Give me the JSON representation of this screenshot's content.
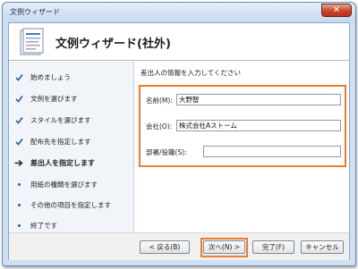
{
  "window": {
    "title": "文例ウィザード",
    "close_glyph": "✕"
  },
  "header": {
    "title": "文例ウィザード(社外)",
    "icon": "document-icon"
  },
  "nav": {
    "items": [
      {
        "label": "始めましょう",
        "state": "done"
      },
      {
        "label": "文例を選びます",
        "state": "done"
      },
      {
        "label": "スタイルを選びます",
        "state": "done"
      },
      {
        "label": "配布先を指定します",
        "state": "done"
      },
      {
        "label": "差出人を指定します",
        "state": "current"
      },
      {
        "label": "用紙の種類を選びます",
        "state": "pending"
      },
      {
        "label": "その他の項目を指定します",
        "state": "pending"
      },
      {
        "label": "終了です",
        "state": "pending"
      }
    ]
  },
  "main": {
    "instruction": "差出人の情報を入力してください",
    "fields": {
      "name": {
        "label": "名前(M):",
        "value": "大野智"
      },
      "company": {
        "label": "会社(O):",
        "value": "株式会社Aストーム"
      },
      "department": {
        "label": "部署/役職(S):",
        "value": ""
      }
    }
  },
  "footer": {
    "back": "< 戻る(B)",
    "next": "次へ(N) >",
    "finish": "完了(F)",
    "cancel": "キャンセル"
  },
  "colors": {
    "highlight": "#ee7a2a",
    "checkmark": "#2f5f8f",
    "close": "#c9432a"
  }
}
